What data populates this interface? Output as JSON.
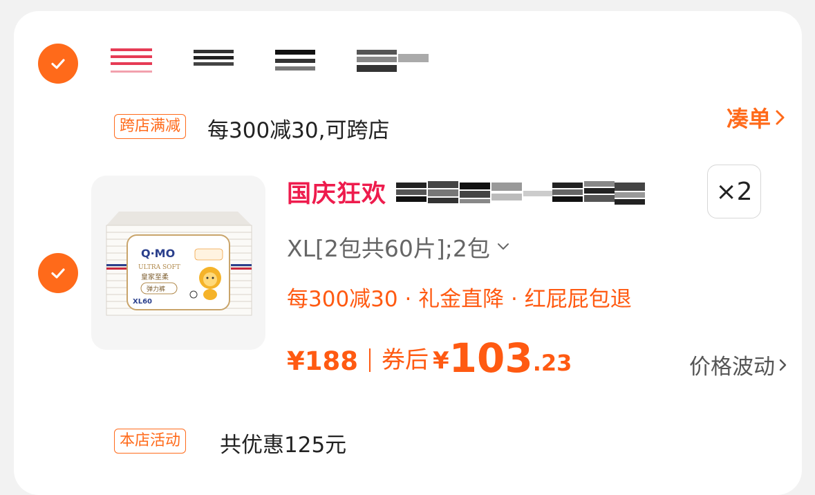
{
  "store": {
    "selected": true
  },
  "cross_store_promo": {
    "tag": "跨店满减",
    "text": "每300减30,可跨店",
    "action_label": "凑单"
  },
  "product": {
    "selected": true,
    "festival_label": "国庆狂欢",
    "quantity": "×2",
    "sku": "XL[2包共60片];2包",
    "discounts": "每300减30 · 礼金直降 · 红屁屁包退",
    "price_original": "¥188",
    "price_after_label": "券后",
    "price_after_currency": "¥",
    "price_after_integer": "103",
    "price_after_decimal": ".23",
    "price_trend_label": "价格波动",
    "image": {
      "brand": "Q·MO",
      "line1": "ULTRA SOFT",
      "line2": "皇家至柔",
      "line3": "弹力裤",
      "size": "XL60"
    }
  },
  "store_promo": {
    "tag": "本店活动",
    "text": "共优惠125元"
  },
  "colors": {
    "accent": "#ff6a1a",
    "price": "#ff5a12",
    "festival": "#ee1c4d"
  }
}
